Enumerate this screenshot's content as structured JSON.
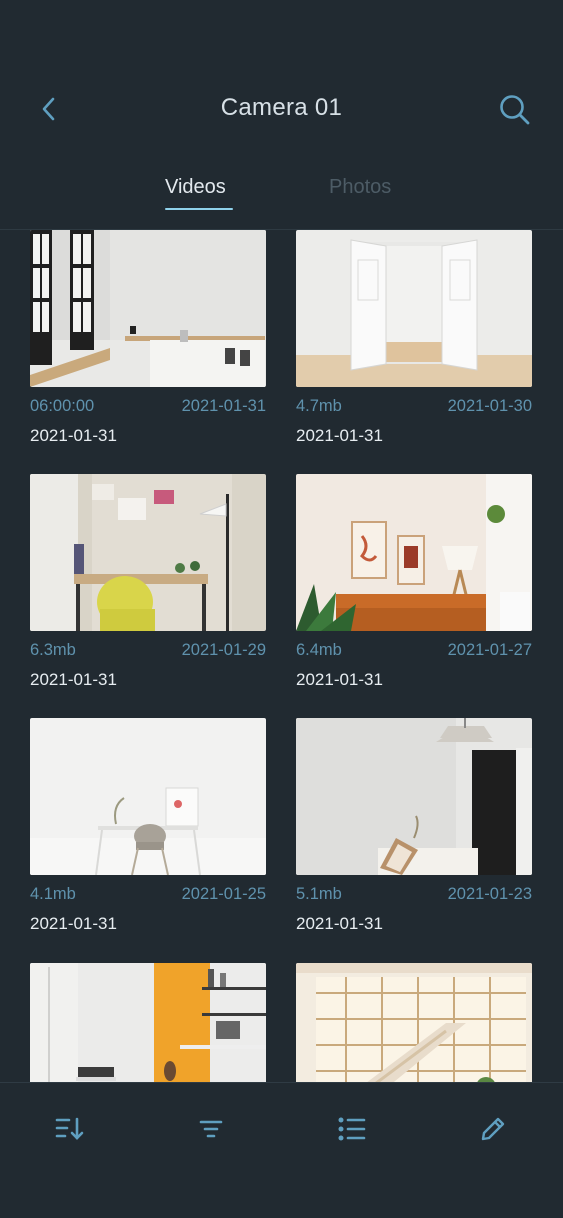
{
  "header": {
    "title": "Camera 01",
    "back_icon": "chevron-left-icon",
    "search_icon": "search-icon"
  },
  "tabs": [
    {
      "label": "Videos",
      "active": true
    },
    {
      "label": "Photos",
      "active": false
    }
  ],
  "items": [
    {
      "left": "06:00:00",
      "right": "2021-01-31",
      "date": "2021-01-31",
      "scene": "white-studio-with-windows"
    },
    {
      "left": "4.7mb",
      "right": "2021-01-30",
      "date": "2021-01-31",
      "scene": "open-double-doors"
    },
    {
      "left": "6.3mb",
      "right": "2021-01-29",
      "date": "2021-01-31",
      "scene": "desk-yellow-chair-lamp"
    },
    {
      "left": "6.4mb",
      "right": "2021-01-27",
      "date": "2021-01-31",
      "scene": "living-room-sofa-plants"
    },
    {
      "left": "4.1mb",
      "right": "2021-01-25",
      "date": "2021-01-31",
      "scene": "minimal-desk-chair"
    },
    {
      "left": "5.1mb",
      "right": "2021-01-23",
      "date": "2021-01-31",
      "scene": "corner-pendant-lamp"
    },
    {
      "left": "",
      "right": "",
      "date": "",
      "scene": "orange-wall-workspace"
    },
    {
      "left": "",
      "right": "",
      "date": "",
      "scene": "bright-loft-staircase"
    }
  ],
  "toolbar": [
    {
      "icon": "sort-icon"
    },
    {
      "icon": "filter-icon"
    },
    {
      "icon": "list-icon"
    },
    {
      "icon": "edit-pencil-icon"
    }
  ],
  "colors": {
    "background": "#212a31",
    "accent": "#5f92ad",
    "tab_active_underline": "#8fd1ea",
    "tab_inactive": "#4d5c66"
  }
}
